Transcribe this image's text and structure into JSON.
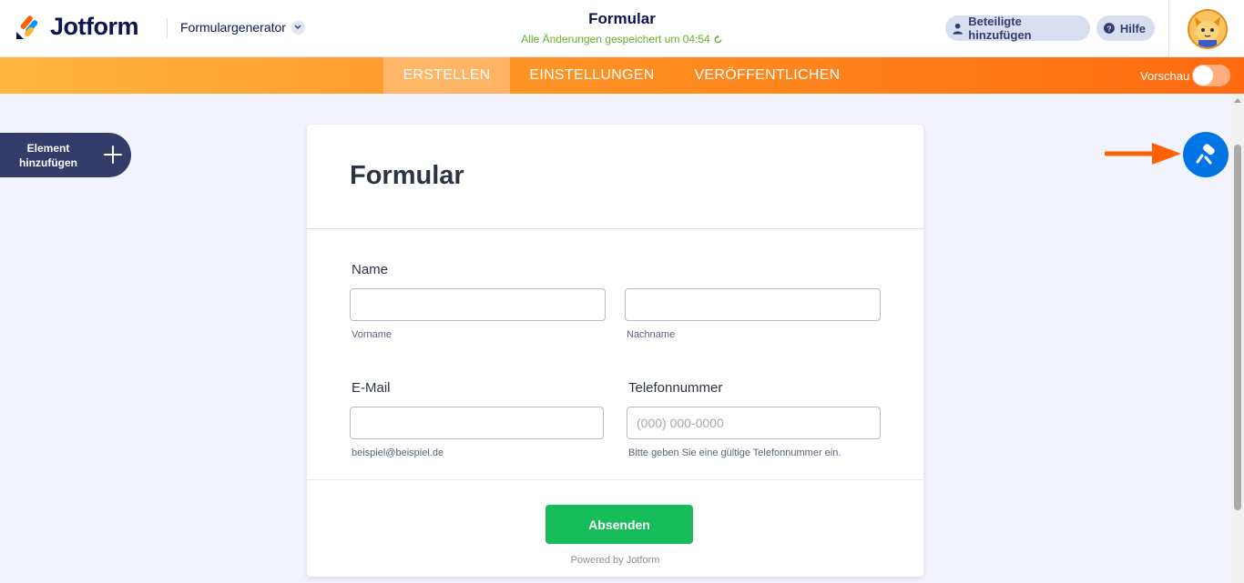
{
  "header": {
    "logo_text": "Jotform",
    "builder_label": "Formulargenerator",
    "form_title": "Formular",
    "save_status": "Alle Änderungen gespeichert um 04:54",
    "share_button": "Beteiligte hinzufügen",
    "help_button": "Hilfe",
    "brand_colors": [
      "#ff6100",
      "#0099ff",
      "#ffb629",
      "#0a1551"
    ]
  },
  "nav": {
    "tabs": [
      {
        "label": "ERSTELLEN",
        "active": true
      },
      {
        "label": "EINSTELLUNGEN",
        "active": false
      },
      {
        "label": "VERÖFFENTLICHEN",
        "active": false
      }
    ],
    "preview_label": "Vorschau",
    "preview_on": false
  },
  "sidebar": {
    "add_element_line1": "Element",
    "add_element_line2": "hinzufügen"
  },
  "form": {
    "title": "Formular",
    "name_label": "Name",
    "first_name_sublabel": "Vorname",
    "last_name_sublabel": "Nachname",
    "first_name_value": "",
    "last_name_value": "",
    "email_label": "E-Mail",
    "email_value": "",
    "email_sublabel": "beispiel@beispiel.de",
    "phone_label": "Telefonnummer",
    "phone_placeholder": "(000) 000-0000",
    "phone_sublabel": "Bitte geben Sie eine gültige Telefonnummer ein.",
    "submit_label": "Absenden",
    "powered_by": "Powered by Jotform"
  },
  "icons": {
    "designer_button": "paint-roller-icon",
    "pointer": "arrow-right-icon",
    "accent": "#0075e3",
    "submit_color": "#18bd5b"
  }
}
